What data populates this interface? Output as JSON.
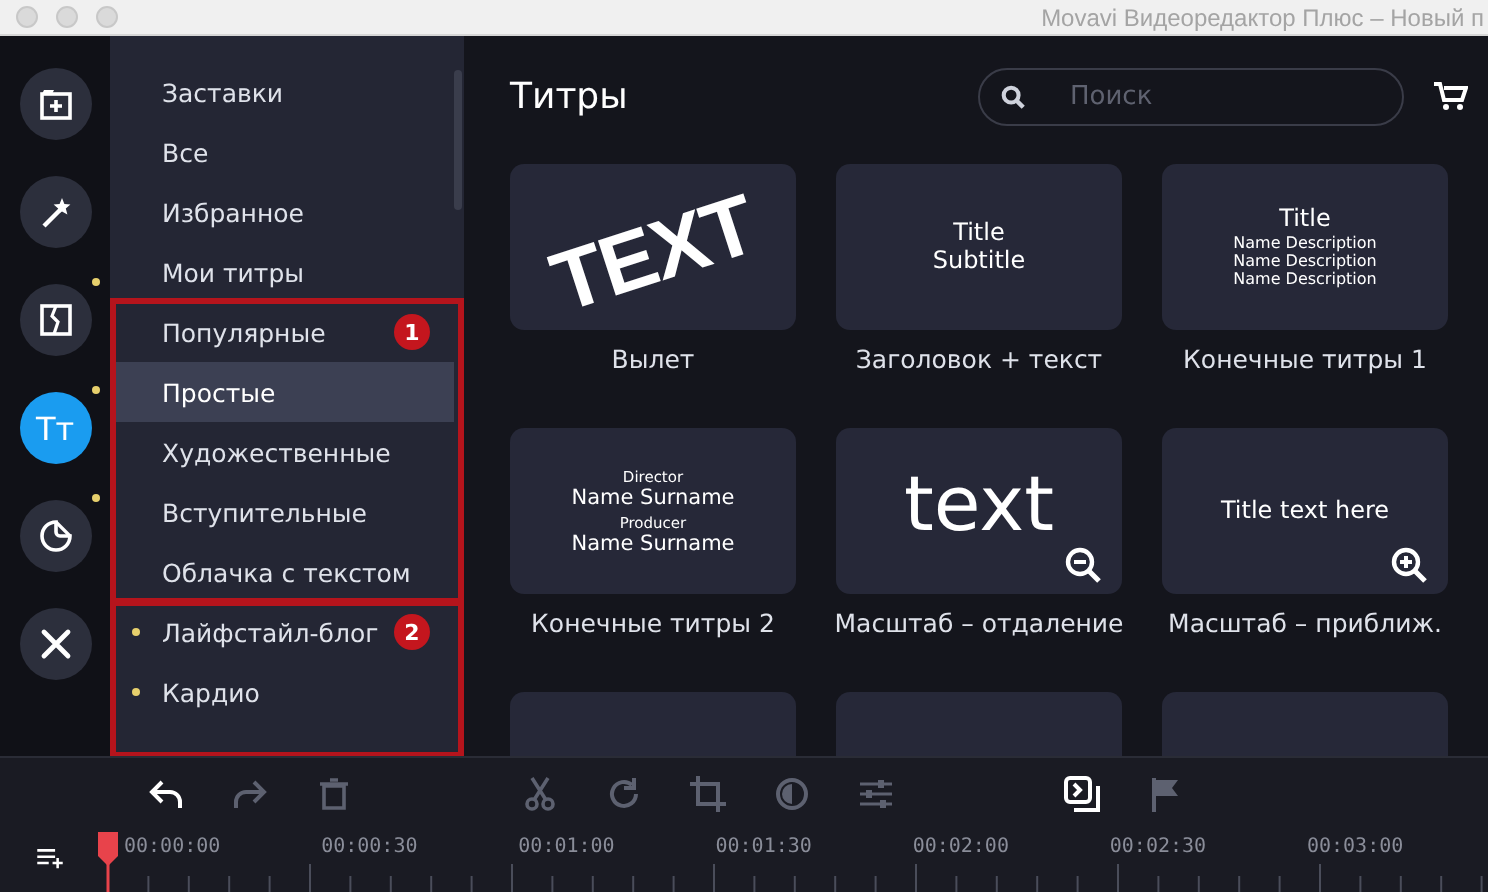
{
  "window": {
    "title": "Movavi Видеоредактор Плюс – Новый п"
  },
  "rail": [
    {
      "kind": "import",
      "selected": false,
      "dot": false
    },
    {
      "kind": "magic",
      "selected": false,
      "dot": false
    },
    {
      "kind": "transition",
      "selected": false,
      "dot": true
    },
    {
      "kind": "titles",
      "selected": true,
      "dot": true,
      "label": "Tт"
    },
    {
      "kind": "sticker",
      "selected": false,
      "dot": true
    },
    {
      "kind": "tools",
      "selected": false,
      "dot": false
    }
  ],
  "category_groups": [
    {
      "items": [
        {
          "label": "Заставки",
          "selected": false,
          "dot": false
        },
        {
          "label": "Все",
          "selected": false,
          "dot": false
        },
        {
          "label": "Избранное",
          "selected": false,
          "dot": false
        },
        {
          "label": "Мои титры",
          "selected": false,
          "dot": false
        }
      ]
    },
    {
      "badge": "1",
      "items": [
        {
          "label": "Популярные",
          "selected": false,
          "dot": false
        },
        {
          "label": "Простые",
          "selected": true,
          "dot": false
        },
        {
          "label": "Художественные",
          "selected": false,
          "dot": false
        },
        {
          "label": "Вступительные",
          "selected": false,
          "dot": false
        },
        {
          "label": "Облачка с текстом",
          "selected": false,
          "dot": false
        }
      ]
    },
    {
      "badge": "2",
      "items": [
        {
          "label": "Лайфстайл-блог",
          "selected": false,
          "dot": true
        },
        {
          "label": "Кардио",
          "selected": false,
          "dot": true
        }
      ]
    }
  ],
  "heading": "Титры",
  "search": {
    "placeholder": "Поиск"
  },
  "cards": [
    {
      "label": "Вылет",
      "preview": {
        "kind": "slant",
        "lines": [
          "TEXT"
        ]
      }
    },
    {
      "label": "Заголовок + текст",
      "preview": {
        "kind": "stack",
        "lines": [
          "Title",
          "Subtitle"
        ]
      }
    },
    {
      "label": "Конечные титры 1",
      "preview": {
        "kind": "credits",
        "lines": [
          "Title",
          "Name Description",
          "Name Description",
          "Name Description"
        ]
      }
    },
    {
      "label": "Конечные титры 2",
      "preview": {
        "kind": "roles",
        "lines": [
          "Director",
          "Name Surname",
          "Producer",
          "Name Surname"
        ]
      }
    },
    {
      "label": "Масштаб – отдаление",
      "preview": {
        "kind": "zoom_out",
        "lines": [
          "text"
        ]
      }
    },
    {
      "label": "Масштаб – приближ.",
      "preview": {
        "kind": "zoom_in",
        "lines": [
          "Title text here"
        ]
      }
    },
    {
      "preview": {
        "kind": "blank"
      }
    },
    {
      "preview": {
        "kind": "blank"
      }
    },
    {
      "preview": {
        "kind": "blank"
      }
    }
  ],
  "toolbar": [
    {
      "kind": "undo",
      "disabled": false
    },
    {
      "kind": "redo",
      "disabled": true
    },
    {
      "kind": "trash",
      "disabled": true
    },
    {
      "kind": "gap"
    },
    {
      "kind": "cut",
      "disabled": true
    },
    {
      "kind": "rotate",
      "disabled": true
    },
    {
      "kind": "crop",
      "disabled": true
    },
    {
      "kind": "color",
      "disabled": true
    },
    {
      "kind": "adjust",
      "disabled": true
    },
    {
      "kind": "gap"
    },
    {
      "kind": "overlay",
      "disabled": false
    },
    {
      "kind": "flag",
      "disabled": true
    }
  ],
  "timeline": {
    "timecodes": [
      "00:00:00",
      "00:00:30",
      "00:01:00",
      "00:01:30",
      "00:02:00",
      "00:02:30",
      "00:03:00"
    ]
  }
}
